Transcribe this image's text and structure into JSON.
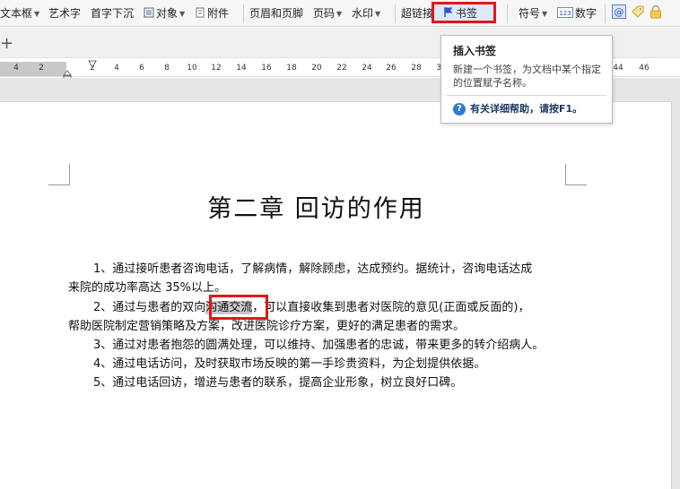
{
  "toolbar": {
    "textbox": "文本框",
    "wordart": "艺术字",
    "dropcap": "首字下沉",
    "object": "对象",
    "attachment": "附件",
    "header_footer": "页眉和页脚",
    "page_number": "页码",
    "watermark": "水印",
    "hyperlink": "超链接",
    "bookmark": "书签",
    "symbol": "符号",
    "number": "数字",
    "number_icon_text": "123"
  },
  "ruler": {
    "labels": [
      "4",
      "2",
      "2",
      "4",
      "6",
      "8",
      "10",
      "12",
      "14",
      "16",
      "18",
      "20",
      "22",
      "24",
      "26",
      "28",
      "30",
      "32",
      "44",
      "46"
    ]
  },
  "tooltip": {
    "title": "插入书签",
    "description": "新建一个书签，为文档中某个指定的位置赋予名称。",
    "help": "有关详细帮助，请按F1。",
    "help_icon_char": "?"
  },
  "document": {
    "title": "第二章  回访的作用",
    "p1_line1": "1、通过接听患者咨询电话，了解病情，解除顾虑，达成预约。据统计，咨询电话达成",
    "p1_line2": "来院的成功率高达 35%以上。",
    "p2_before": "2、通过与患者的双向",
    "p2_highlight": "沟通交流",
    "p2_after": "，可以直接收集到患者对医院的意见(正面或反面的)，",
    "p2_line2": "帮助医院制定营销策略及方案，改进医院诊疗方案，更好的满足患者的需求。",
    "p3": "3、通过对患者抱怨的圆满处理，可以维持、加强患者的忠诚，带来更多的转介绍病人。",
    "p4": "4、通过电话访问，及时获取市场反映的第一手珍贵资料，为企划提供依据。",
    "p5": "5、通过电话回访，增进与患者的联系，提高企业形象，树立良好口碑。"
  },
  "colors": {
    "highlight_box": "#e01818",
    "bookmark_flag": "#2a56c6",
    "help_icon": "#2e7bd6"
  }
}
